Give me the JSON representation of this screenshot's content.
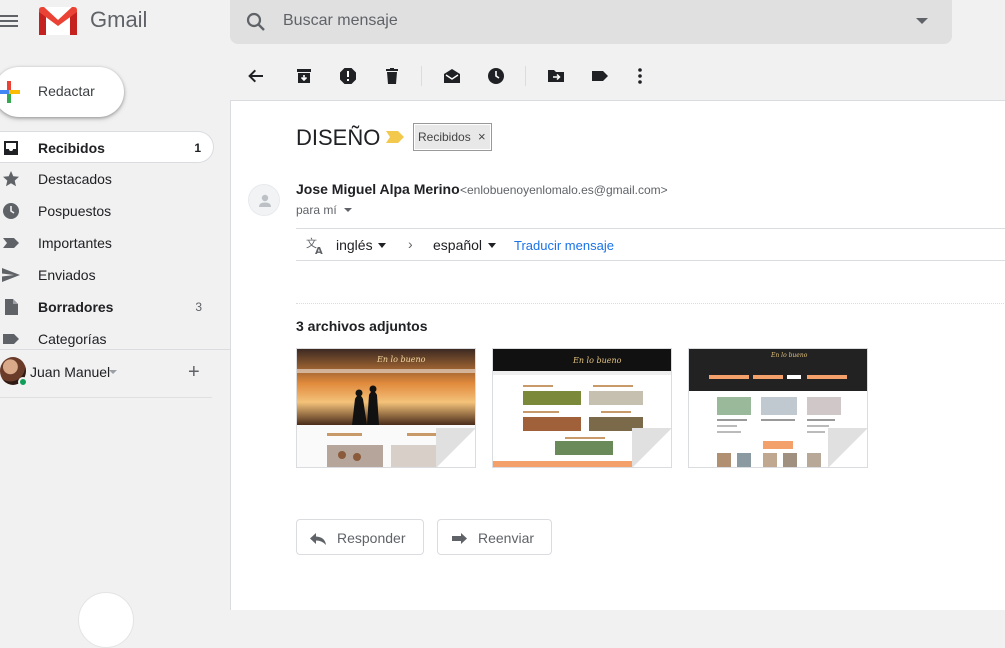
{
  "app": {
    "name": "Gmail"
  },
  "search": {
    "placeholder": "Buscar mensaje"
  },
  "compose": {
    "label": "Redactar"
  },
  "sidebar": {
    "items": [
      {
        "label": "Recibidos",
        "count": "1",
        "active": true,
        "icon": "inbox-icon"
      },
      {
        "label": "Destacados",
        "count": "",
        "icon": "star-icon"
      },
      {
        "label": "Pospuestos",
        "count": "",
        "icon": "clock-icon"
      },
      {
        "label": "Importantes",
        "count": "",
        "icon": "important-icon"
      },
      {
        "label": "Enviados",
        "count": "",
        "icon": "send-icon"
      },
      {
        "label": "Borradores",
        "count": "3",
        "icon": "draft-icon"
      },
      {
        "label": "Categorías",
        "count": "",
        "icon": "label-icon"
      }
    ],
    "user": {
      "name": "Juan Manuel"
    }
  },
  "email": {
    "subject": "DISEÑO",
    "label": "Recibidos",
    "label_close": "×",
    "sender_name": "Jose Miguel Alpa Merino",
    "sender_email": "<enlobuenoyenlomalo.es@gmail.com>",
    "recipient": "para mí",
    "translate": {
      "source": "inglés",
      "target": "español",
      "link": "Traducir mensaje"
    },
    "attachments_title": "3 archivos adjuntos",
    "attachments": [
      {
        "name": "attachment-1"
      },
      {
        "name": "attachment-2"
      },
      {
        "name": "attachment-3"
      }
    ],
    "reply_label": "Responder",
    "forward_label": "Reenviar"
  },
  "colors": {
    "accent": "#1a73e8",
    "importance": "#f2c94c",
    "background": "#f1f1f1"
  }
}
